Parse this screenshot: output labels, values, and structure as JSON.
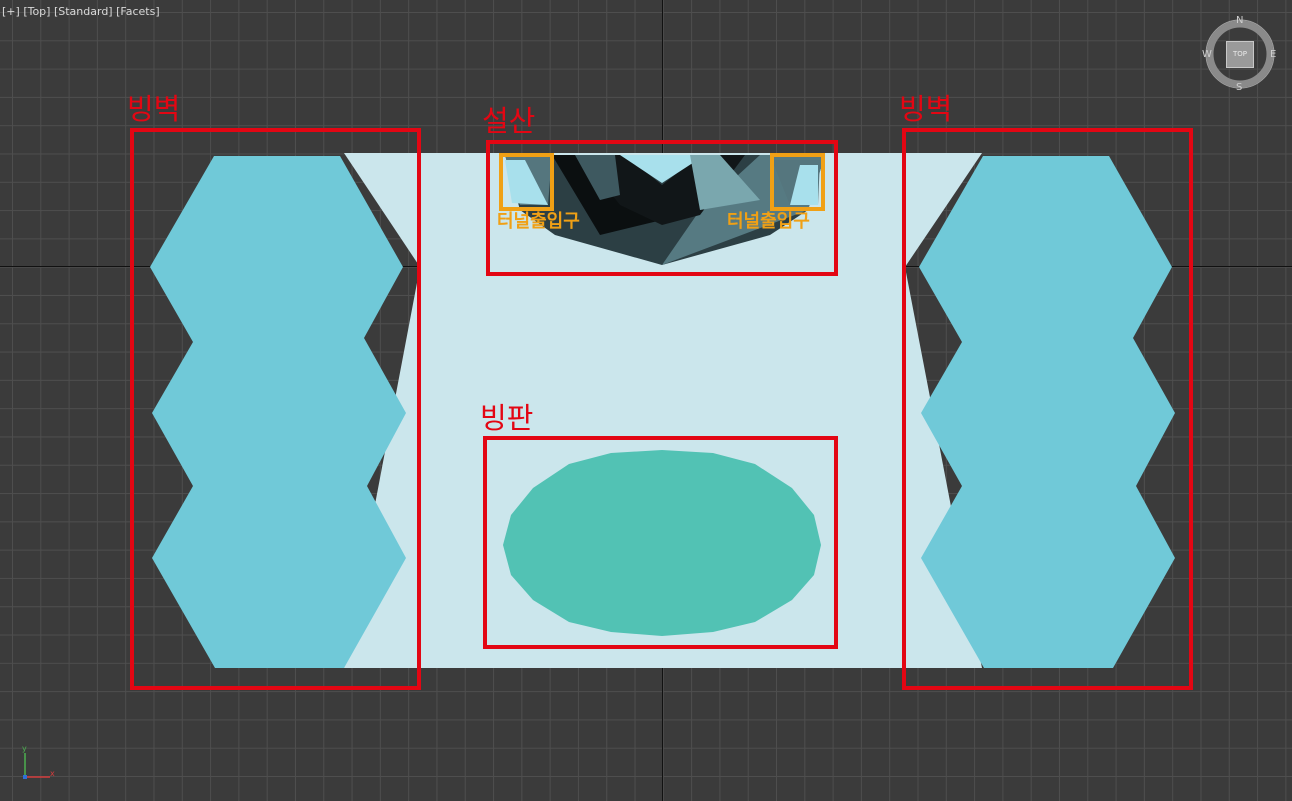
{
  "viewport": {
    "labels": [
      "[+]",
      "[Top]",
      "[Standard]",
      "[Facets]"
    ],
    "view_name": "Top"
  },
  "viewcube": {
    "north": "N",
    "south": "S",
    "east": "E",
    "west": "W",
    "face": "TOP"
  },
  "tripod": {
    "x": "x",
    "y": "y"
  },
  "annotations": {
    "left_wall": "빙벽",
    "right_wall": "빙벽",
    "snow_mountain": "설산",
    "ice_plate": "빙판",
    "tunnel_left": "터널출입구",
    "tunnel_right": "터널출입구"
  },
  "colors": {
    "background": "#3b3b3b",
    "grid": "#4e4e4e",
    "ground": "#cbe6ec",
    "ice_wall": "#70c9d8",
    "ice_plate": "#52c2b4",
    "annotation_red": "#e30613",
    "annotation_orange": "#f0a015"
  }
}
